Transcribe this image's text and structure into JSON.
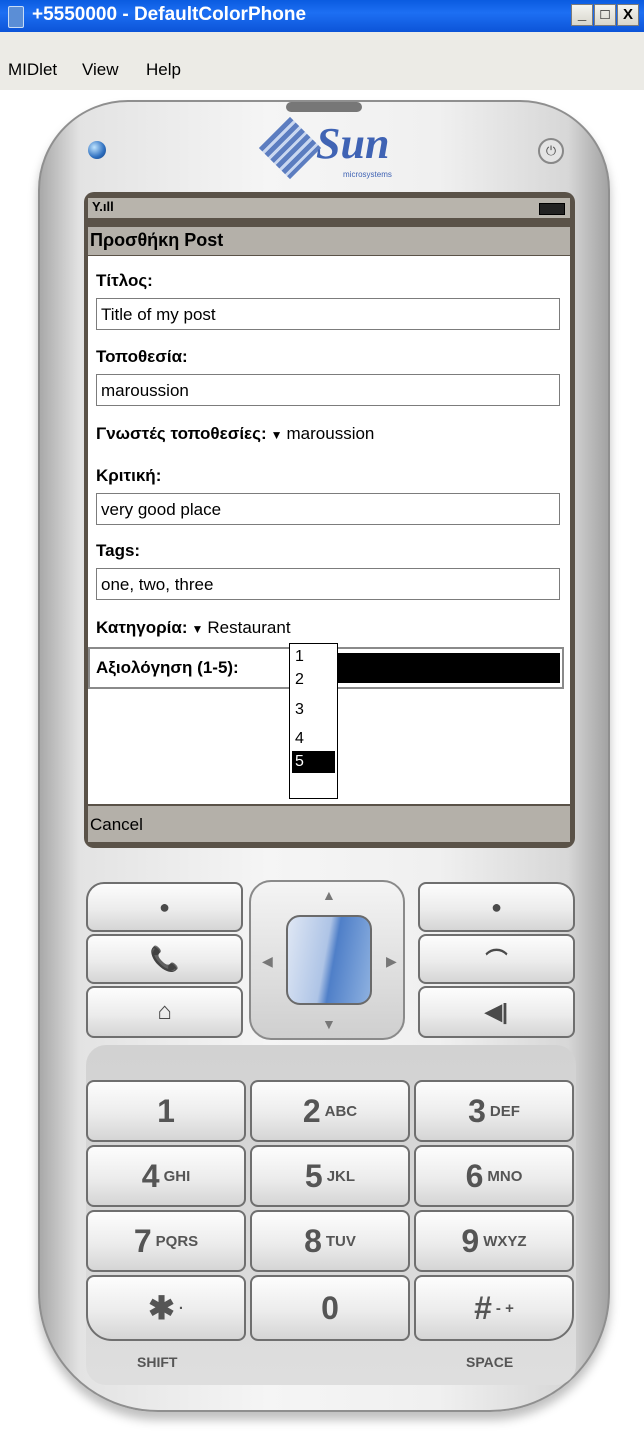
{
  "window": {
    "title": "+5550000 - DefaultColorPhone",
    "min_label": "_",
    "max_label": "□",
    "close_label": "X"
  },
  "menu": {
    "items": [
      "MIDlet",
      "View",
      "Help"
    ]
  },
  "phone": {
    "brand": "Sun",
    "brand_sub": "microsystems",
    "power_glyph": "⏻",
    "status": {
      "signal": "Y.ıll"
    },
    "app_title": "Προσθήκη Post",
    "form": {
      "title_label": "Τίτλος:",
      "title_value": "Title of my post",
      "location_label": "Τοποθεσία:",
      "location_value": "maroussion",
      "known_label": "Γνωστές τοποθεσίες:",
      "known_value": "maroussion",
      "review_label": "Κριτική:",
      "review_value": "very good place",
      "tags_label": "Tags:",
      "tags_value": "one, two, three",
      "category_label": "Κατηγορία:",
      "category_value": "Restaurant",
      "rating_label": "Αξιολόγηση (1-5):",
      "rating_options": [
        "1",
        "2",
        "3",
        "4",
        "5"
      ],
      "rating_selected": "5"
    },
    "softkey_left": "Cancel",
    "keypad": {
      "k1": "1",
      "k2": "2",
      "k2l": "ABC",
      "k3": "3",
      "k3l": "DEF",
      "k4": "4",
      "k4l": "GHI",
      "k5": "5",
      "k5l": "JKL",
      "k6": "6",
      "k6l": "MNO",
      "k7": "7",
      "k7l": "PQRS",
      "k8": "8",
      "k8l": "TUV",
      "k9": "9",
      "k9l": "WXYZ",
      "kstar": "✱",
      "kstar_l": "·",
      "k0": "0",
      "khash": "#",
      "khash_l": "- +",
      "shift_label": "SHIFT",
      "space_label": "SPACE"
    },
    "nav_icons": [
      "softkey-left-dot",
      "call-icon",
      "home-icon",
      "softkey-right-dot",
      "hangup-icon",
      "clear-icon"
    ]
  }
}
